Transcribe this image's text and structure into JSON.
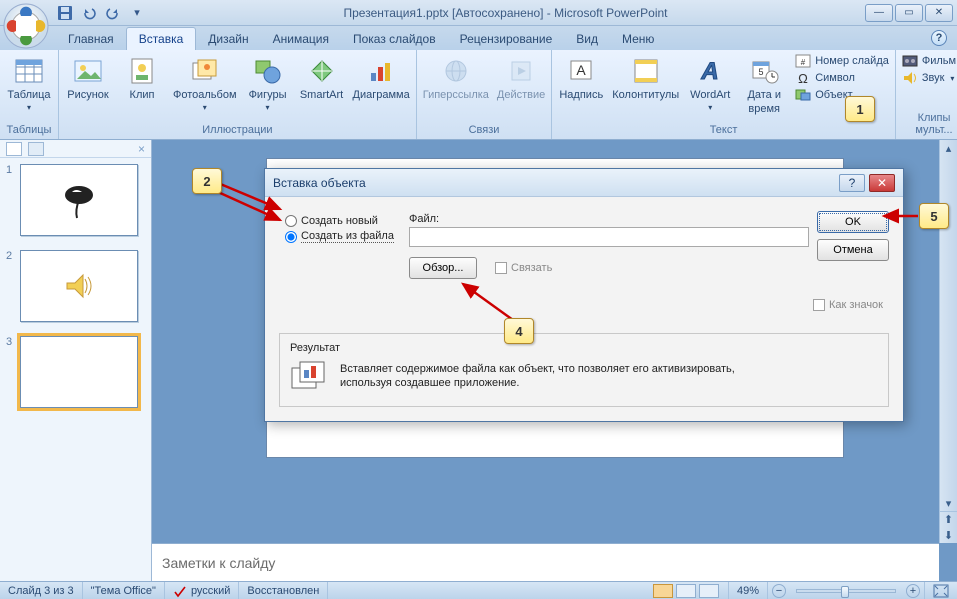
{
  "title": "Презентация1.pptx [Автосохранено] - Microsoft PowerPoint",
  "tabs": [
    "Главная",
    "Вставка",
    "Дизайн",
    "Анимация",
    "Показ слайдов",
    "Рецензирование",
    "Вид",
    "Меню"
  ],
  "active_tab_index": 1,
  "ribbon": {
    "groups": {
      "tables": {
        "label": "Таблицы",
        "table": "Таблица"
      },
      "illustrations": {
        "label": "Иллюстрации",
        "picture": "Рисунок",
        "clip": "Клип",
        "album": "Фотоальбом",
        "shapes": "Фигуры",
        "smartart": "SmartArt",
        "chart": "Диаграмма"
      },
      "links": {
        "label": "Связи",
        "hyperlink": "Гиперссылка",
        "action": "Действие"
      },
      "text": {
        "label": "Текст",
        "textbox": "Надпись",
        "headerfooter": "Колонтитулы",
        "wordart": "WordArt",
        "datetime_l1": "Дата и",
        "datetime_l2": "время",
        "slidenum": "Номер слайда",
        "symbol": "Символ",
        "object": "Объект"
      },
      "media": {
        "label": "Клипы мульт...",
        "movie": "Фильм",
        "sound": "Звук"
      }
    }
  },
  "dialog": {
    "title": "Вставка объекта",
    "radio_new": "Создать новый",
    "radio_file": "Создать из файла",
    "file_label": "Файл:",
    "file_value": "",
    "browse": "Обзор...",
    "link": "Связать",
    "as_icon": "Как значок",
    "result_title": "Результат",
    "result_text": "Вставляет содержимое файла как объект, что позволяет его активизировать, используя создавшее приложение.",
    "ok": "OK",
    "cancel": "Отмена"
  },
  "callouts": {
    "c1": "1",
    "c2": "2",
    "c4": "4",
    "c5": "5"
  },
  "slides": [
    "1",
    "2",
    "3"
  ],
  "notes_placeholder": "Заметки к слайду",
  "status": {
    "slide": "Слайд 3 из 3",
    "theme": "\"Тема Office\"",
    "lang": "русский",
    "autosave": "Восстановлен",
    "zoom": "49%"
  }
}
